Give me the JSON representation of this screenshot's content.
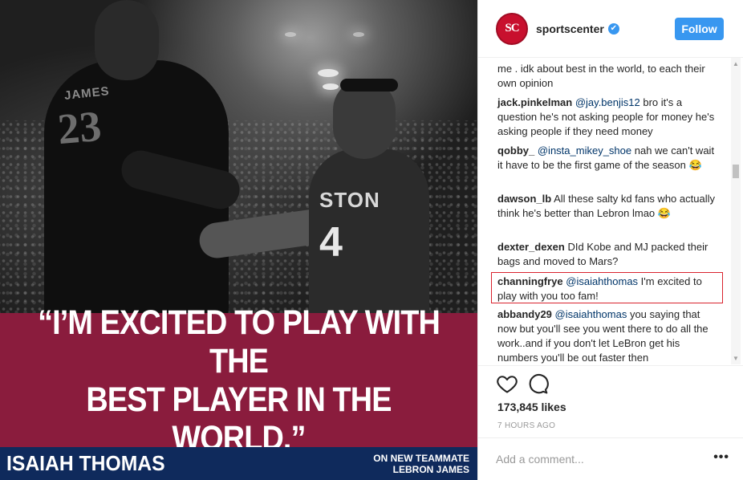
{
  "post": {
    "quote": "“I’M EXCITED TO PLAY WITH THE\nBEST PLAYER IN THE WORLD.”",
    "speaker": "ISAIAH THOMAS",
    "subtitle_line1": "ON NEW TEAMMATE",
    "subtitle_line2": "LEBRON JAMES",
    "jersey_a_name": "JAMES",
    "jersey_a_number": "23",
    "jersey_b_name": "STON",
    "jersey_b_number": "4"
  },
  "header": {
    "avatar_text": "SC",
    "username": "sportscenter",
    "verified_icon": "✔",
    "follow_label": "Follow"
  },
  "comments": [
    {
      "user": "",
      "mention": "",
      "text": "me . idk about best in the world, to each their own opinion"
    },
    {
      "user": "jack.pinkelman",
      "mention": "@jay.benjis12",
      "text": " bro it's a question he's not asking people for money he's asking people if they need money"
    },
    {
      "user": "qobby_",
      "mention": "@insta_mikey_shoe",
      "text": " nah we can't wait it have to be the first game of the season 😂"
    },
    {
      "user": "dawson_lb",
      "mention": "",
      "text": "All these salty kd fans who actually think he's better than Lebron lmao 😂"
    },
    {
      "user": "dexter_dexen",
      "mention": "",
      "text": "DId Kobe and MJ packed their bags and moved to Mars?"
    },
    {
      "user": "channingfrye",
      "mention": "@isaiahthomas",
      "text": " I'm excited to play with you too fam!"
    },
    {
      "user": "abbandy29",
      "mention": "@isaiahthomas",
      "text": " you saying that now but you'll see you went there to do all the work..and if you don't let LeBron get his numbers you'll be out faster then"
    }
  ],
  "actions": {
    "like_icon": "heart-icon",
    "comment_icon": "comment-icon",
    "likes": "173,845 likes",
    "timestamp": "7 HOURS AGO"
  },
  "add_comment": {
    "placeholder": "Add a comment...",
    "more_label": "•••"
  },
  "colors": {
    "quote_band": "#8a1c3d",
    "name_band": "#0f2a5c",
    "follow": "#3897f0",
    "highlight": "#d9232e",
    "mention": "#003569"
  }
}
